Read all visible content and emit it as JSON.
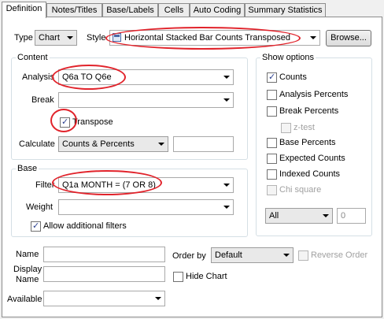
{
  "tabs": [
    {
      "label": "Definition"
    },
    {
      "label": "Notes/Titles"
    },
    {
      "label": "Base/Labels"
    },
    {
      "label": "Cells"
    },
    {
      "label": "Auto Coding"
    },
    {
      "label": "Summary Statistics"
    }
  ],
  "top": {
    "type_label": "Type",
    "type_value": "Chart",
    "style_label": "Style",
    "style_value": "Horizontal Stacked Bar Counts Transposed",
    "browse_label": "Browse..."
  },
  "content": {
    "title": "Content",
    "analysis_label": "Analysis",
    "analysis_value": "Q6a TO Q6e",
    "break_label": "Break",
    "break_value": "",
    "transpose_label": "Transpose",
    "transpose_checked": true,
    "calculate_label": "Calculate",
    "calculate_value": "Counts & Percents",
    "calculate_extra": ""
  },
  "base": {
    "title": "Base",
    "filter_label": "Filter",
    "filter_value": "Q1a MONTH = (7 OR 8)",
    "weight_label": "Weight",
    "weight_value": "",
    "allow_filters_label": "Allow additional filters",
    "allow_filters_checked": true
  },
  "show_options": {
    "title": "Show options",
    "items": [
      {
        "label": "Counts",
        "checked": true,
        "disabled": false
      },
      {
        "label": "Analysis Percents",
        "checked": false,
        "disabled": false
      },
      {
        "label": "Break Percents",
        "checked": false,
        "disabled": false
      },
      {
        "label": "z-test",
        "checked": false,
        "disabled": true
      },
      {
        "label": "Base Percents",
        "checked": false,
        "disabled": false
      },
      {
        "label": "Expected Counts",
        "checked": false,
        "disabled": false
      },
      {
        "label": "Indexed Counts",
        "checked": false,
        "disabled": false
      },
      {
        "label": "Chi square",
        "checked": false,
        "disabled": true
      }
    ],
    "scope_value": "All",
    "scope_number": "0"
  },
  "bottom": {
    "name_label": "Name",
    "name_value": "",
    "display_name_label_1": "Display",
    "display_name_label_2": "Name",
    "display_name_value": "",
    "available_label": "Available",
    "available_value": "",
    "order_by_label": "Order by",
    "order_by_value": "Default",
    "reverse_order_label": "Reverse Order",
    "hide_chart_label": "Hide Chart"
  },
  "colors": {
    "highlight_ring": "#e1232b",
    "check_mark": "#2a3f8f"
  }
}
